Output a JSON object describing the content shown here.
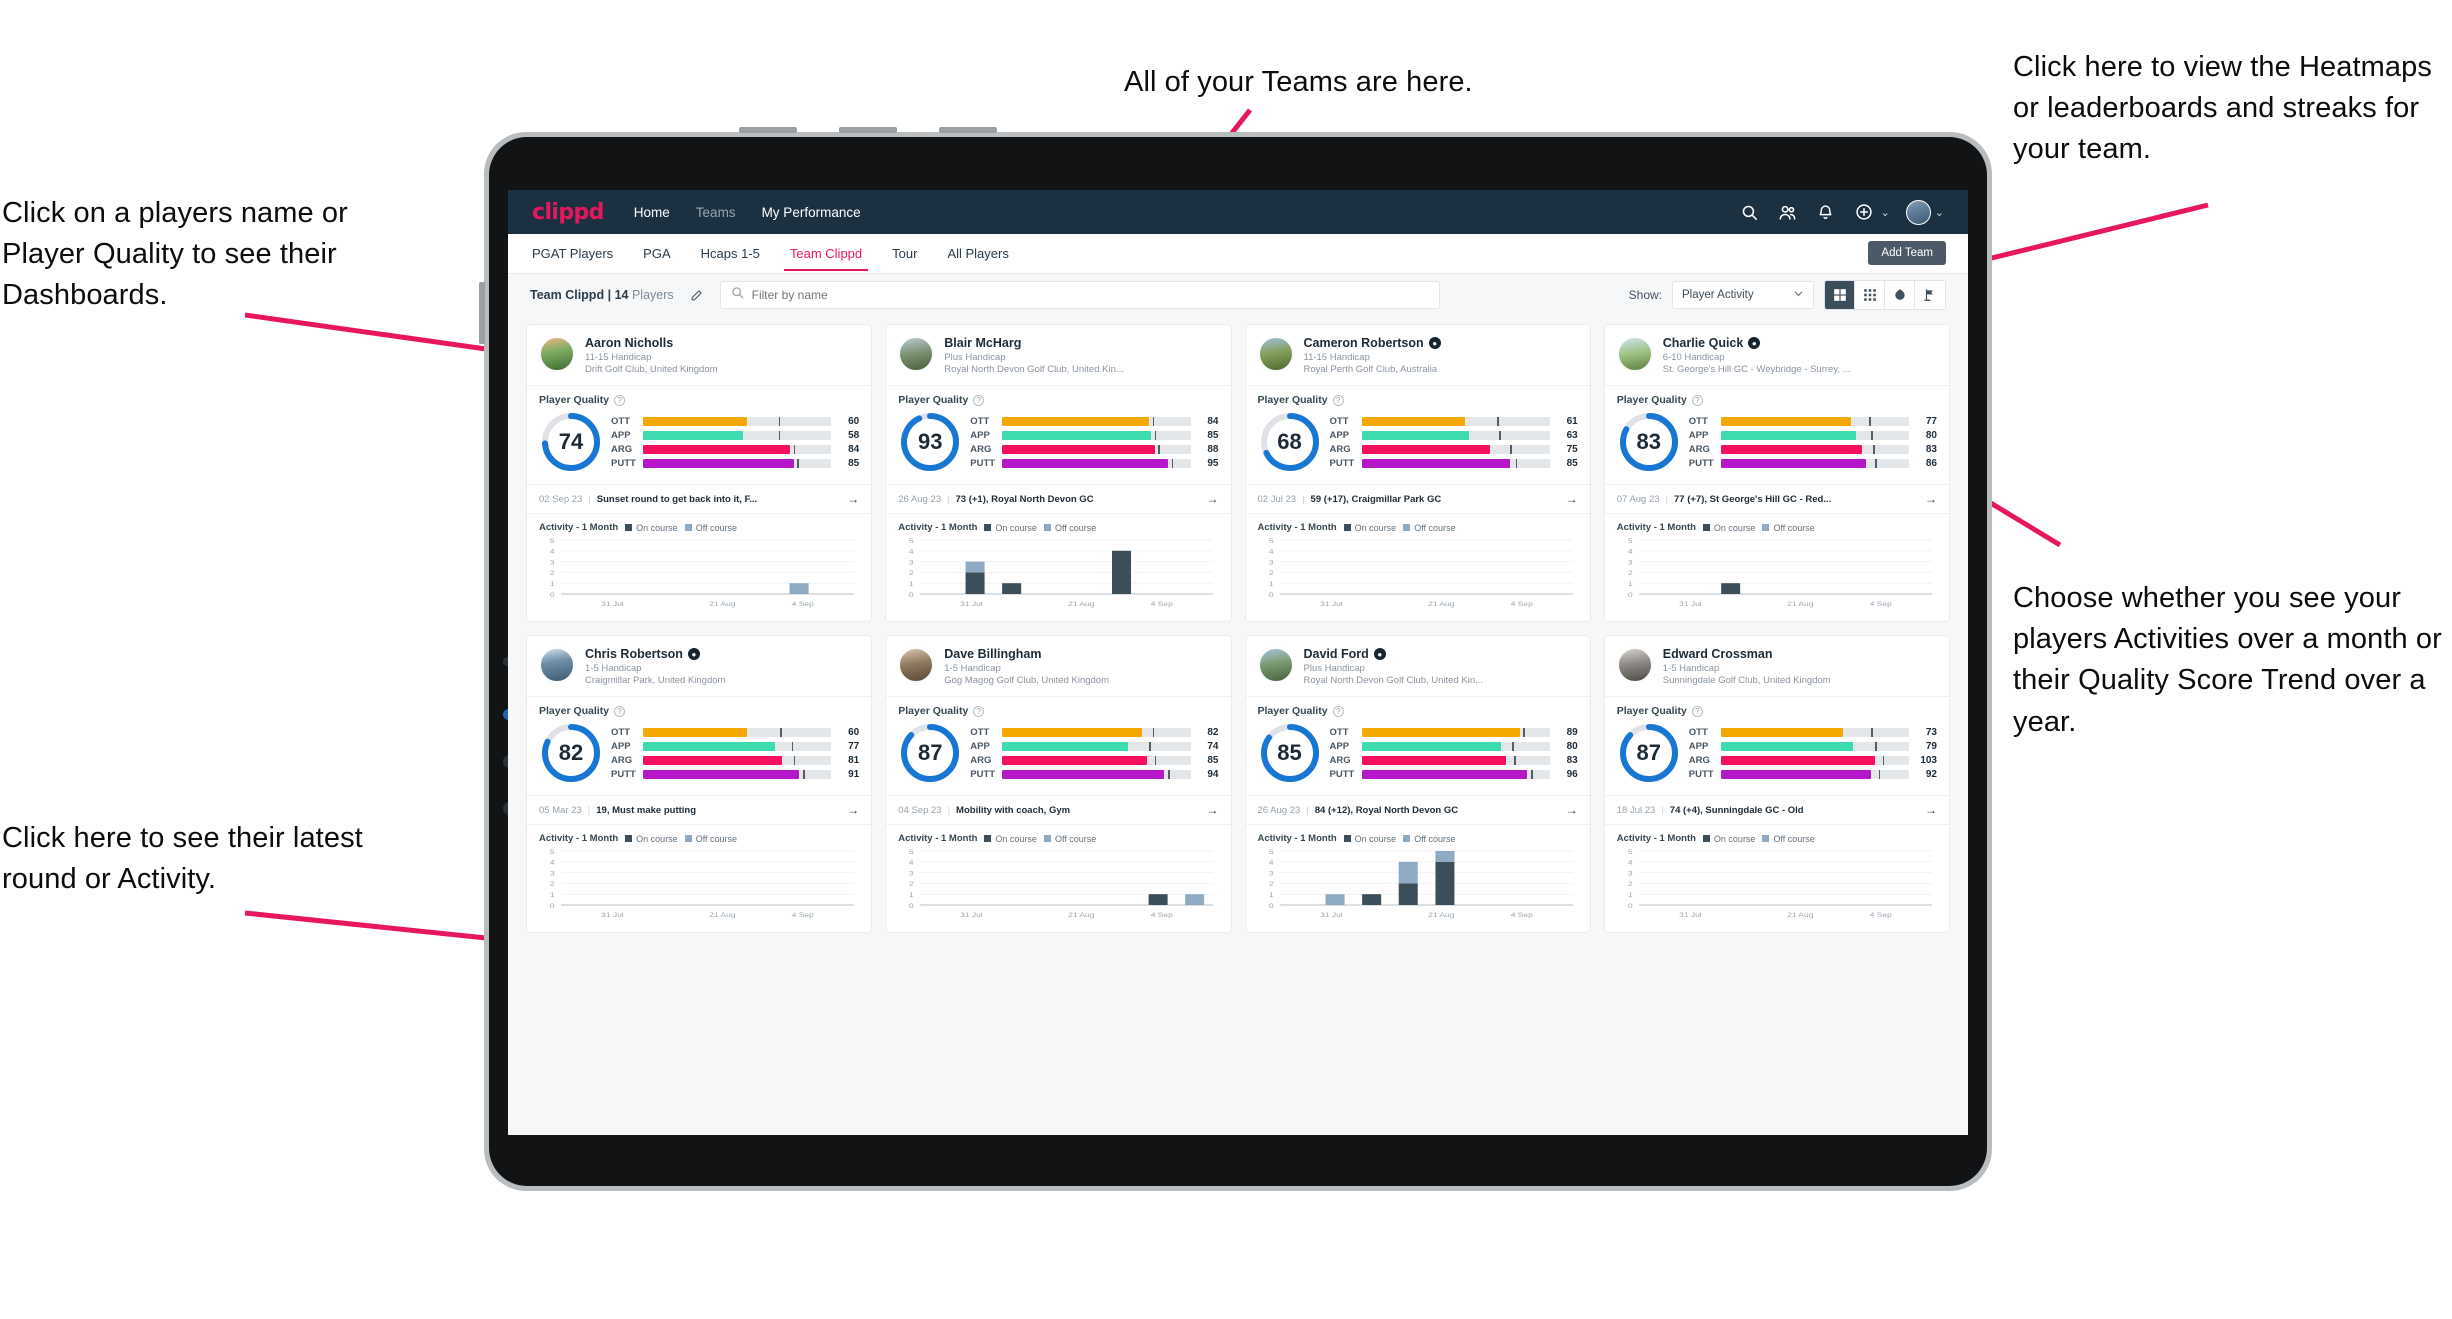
{
  "annotations": {
    "top_left": "Click on a players name or Player Quality to see their Dashboards.",
    "bottom_left": "Click here to see their latest round or Activity.",
    "top_center": "All of your Teams are here.",
    "top_right": "Click here to view the Heatmaps or leaderboards and streaks for your team.",
    "bottom_right": "Choose whether you see your players Activities over a month or their Quality Score Trend over a year.",
    "arrow_color": "#e8175d"
  },
  "topnav": {
    "logo": "clippd",
    "links": [
      {
        "label": "Home",
        "active": true
      },
      {
        "label": "Teams",
        "active": false
      },
      {
        "label": "My Performance",
        "active": true
      }
    ],
    "icons": [
      {
        "name": "search-icon"
      },
      {
        "name": "people-icon"
      },
      {
        "name": "bell-icon"
      },
      {
        "name": "plus-circle-icon"
      }
    ],
    "avatar_caret": "⌄",
    "plus_caret": "⌄"
  },
  "tabs": {
    "items": [
      {
        "label": "PGAT Players",
        "state": "dark"
      },
      {
        "label": "PGA",
        "state": "dark"
      },
      {
        "label": "Hcaps 1-5",
        "state": "dark"
      },
      {
        "label": "Team Clippd",
        "state": "active"
      },
      {
        "label": "Tour",
        "state": "dark"
      },
      {
        "label": "All Players",
        "state": "dark"
      }
    ],
    "add_team_label": "Add Team"
  },
  "filterbar": {
    "team_name": "Team Clippd",
    "divider": "|",
    "player_count": "14",
    "players_word": "Players",
    "edit_icon": "pencil-icon",
    "search_placeholder": "Filter by name",
    "search_value": "",
    "show_label": "Show:",
    "show_selected": "Player Activity",
    "show_options": [
      "Player Activity",
      "Quality Score Trend"
    ],
    "view_buttons": [
      {
        "name": "grid-large-view",
        "selected": true
      },
      {
        "name": "grid-small-view",
        "selected": false
      },
      {
        "name": "heatmap-view",
        "selected": false
      },
      {
        "name": "leaderboard-view",
        "selected": false
      }
    ]
  },
  "card_labels": {
    "player_quality": "Player Quality",
    "activity_title": "Activity - 1 Month",
    "legend_on": "On course",
    "legend_off": "Off course",
    "metric_names": [
      "OTT",
      "APP",
      "ARG",
      "PUTT"
    ],
    "arrow": "→"
  },
  "chart_data": {
    "type": "bar",
    "title": "Activity - 1 Month",
    "xlabel": "",
    "ylabel": "",
    "ylim": [
      0,
      5
    ],
    "yticks": [
      0,
      1,
      2,
      3,
      4,
      5
    ],
    "xtick_labels": [
      "31 Jul",
      "21 Aug",
      "4 Sep"
    ],
    "grid": true,
    "legend_position": "top",
    "stacked": true,
    "series_names": [
      "On course",
      "Off course"
    ],
    "series_colors": {
      "On course": "#3d4e5b",
      "Off course": "#8fabc4"
    },
    "charts": [
      {
        "player": "Aaron Nicholls",
        "bins": [
          {
            "slot": 6,
            "on": 0,
            "off": 1
          }
        ]
      },
      {
        "player": "Blair McHarg",
        "bins": [
          {
            "slot": 1,
            "on": 2,
            "off": 1
          },
          {
            "slot": 2,
            "on": 1,
            "off": 0
          },
          {
            "slot": 5,
            "on": 4,
            "off": 0
          }
        ]
      },
      {
        "player": "Cameron Robertson",
        "bins": []
      },
      {
        "player": "Charlie Quick",
        "bins": [
          {
            "slot": 2,
            "on": 1,
            "off": 0
          }
        ]
      },
      {
        "player": "Chris Robertson",
        "bins": []
      },
      {
        "player": "Dave Billingham",
        "bins": [
          {
            "slot": 6,
            "on": 1,
            "off": 0
          },
          {
            "slot": 7,
            "on": 0,
            "off": 1
          }
        ]
      },
      {
        "player": "David Ford",
        "bins": [
          {
            "slot": 1,
            "on": 0,
            "off": 1
          },
          {
            "slot": 2,
            "on": 1,
            "off": 0
          },
          {
            "slot": 3,
            "on": 2,
            "off": 2
          },
          {
            "slot": 4,
            "on": 4,
            "off": 1
          }
        ]
      },
      {
        "player": "Edward Crossman",
        "bins": []
      }
    ]
  },
  "players": [
    {
      "name": "Aaron Nicholls",
      "verified": false,
      "handicap": "11-15 Handicap",
      "club": "Drift Golf Club, United Kingdom",
      "quality": 74,
      "metrics": [
        {
          "label": "OTT",
          "value": 60,
          "fill": 55,
          "tick": 72,
          "color": "#f5a800"
        },
        {
          "label": "APP",
          "value": 58,
          "fill": 53,
          "tick": 72,
          "color": "#3ddbb0"
        },
        {
          "label": "ARG",
          "value": 84,
          "fill": 78,
          "tick": 80,
          "color": "#f50f5f"
        },
        {
          "label": "PUTT",
          "value": 85,
          "fill": 80,
          "tick": 82,
          "color": "#b617c9"
        }
      ],
      "round_date": "02 Sep 23",
      "round_text": "Sunset round to get back into it, F..."
    },
    {
      "name": "Blair McHarg",
      "verified": false,
      "handicap": "Plus Handicap",
      "club": "Royal North Devon Golf Club, United Kin...",
      "quality": 93,
      "metrics": [
        {
          "label": "OTT",
          "value": 84,
          "fill": 78,
          "tick": 80,
          "color": "#f5a800"
        },
        {
          "label": "APP",
          "value": 85,
          "fill": 79,
          "tick": 81,
          "color": "#3ddbb0"
        },
        {
          "label": "ARG",
          "value": 88,
          "fill": 81,
          "tick": 83,
          "color": "#f50f5f"
        },
        {
          "label": "PUTT",
          "value": 95,
          "fill": 88,
          "tick": 90,
          "color": "#b617c9"
        }
      ],
      "round_date": "26 Aug 23",
      "round_text": "73 (+1), Royal North Devon GC"
    },
    {
      "name": "Cameron Robertson",
      "verified": true,
      "handicap": "11-15 Handicap",
      "club": "Royal Perth Golf Club, Australia",
      "quality": 68,
      "metrics": [
        {
          "label": "OTT",
          "value": 61,
          "fill": 55,
          "tick": 72,
          "color": "#f5a800"
        },
        {
          "label": "APP",
          "value": 63,
          "fill": 57,
          "tick": 73,
          "color": "#3ddbb0"
        },
        {
          "label": "ARG",
          "value": 75,
          "fill": 68,
          "tick": 79,
          "color": "#f50f5f"
        },
        {
          "label": "PUTT",
          "value": 85,
          "fill": 79,
          "tick": 82,
          "color": "#b617c9"
        }
      ],
      "round_date": "02 Jul 23",
      "round_text": "59 (+17), Craigmillar Park GC"
    },
    {
      "name": "Charlie Quick",
      "verified": true,
      "handicap": "6-10 Handicap",
      "club": "St. George's Hill GC - Weybridge - Surrey, ...",
      "quality": 83,
      "metrics": [
        {
          "label": "OTT",
          "value": 77,
          "fill": 69,
          "tick": 79,
          "color": "#f5a800"
        },
        {
          "label": "APP",
          "value": 80,
          "fill": 72,
          "tick": 80,
          "color": "#3ddbb0"
        },
        {
          "label": "ARG",
          "value": 83,
          "fill": 75,
          "tick": 81,
          "color": "#f50f5f"
        },
        {
          "label": "PUTT",
          "value": 86,
          "fill": 77,
          "tick": 82,
          "color": "#b617c9"
        }
      ],
      "round_date": "07 Aug 23",
      "round_text": "77 (+7), St George's Hill GC - Red..."
    },
    {
      "name": "Chris Robertson",
      "verified": true,
      "handicap": "1-5 Handicap",
      "club": "Craigmillar Park, United Kingdom",
      "quality": 82,
      "metrics": [
        {
          "label": "OTT",
          "value": 60,
          "fill": 55,
          "tick": 73,
          "color": "#f5a800"
        },
        {
          "label": "APP",
          "value": 77,
          "fill": 70,
          "tick": 79,
          "color": "#3ddbb0"
        },
        {
          "label": "ARG",
          "value": 81,
          "fill": 74,
          "tick": 80,
          "color": "#f50f5f"
        },
        {
          "label": "PUTT",
          "value": 91,
          "fill": 83,
          "tick": 85,
          "color": "#b617c9"
        }
      ],
      "round_date": "05 Mar 23",
      "round_text": "19, Must make putting"
    },
    {
      "name": "Dave Billingham",
      "verified": false,
      "handicap": "1-5 Handicap",
      "club": "Gog Magog Golf Club, United Kingdom",
      "quality": 87,
      "metrics": [
        {
          "label": "OTT",
          "value": 82,
          "fill": 74,
          "tick": 80,
          "color": "#f5a800"
        },
        {
          "label": "APP",
          "value": 74,
          "fill": 67,
          "tick": 78,
          "color": "#3ddbb0"
        },
        {
          "label": "ARG",
          "value": 85,
          "fill": 77,
          "tick": 81,
          "color": "#f50f5f"
        },
        {
          "label": "PUTT",
          "value": 94,
          "fill": 86,
          "tick": 88,
          "color": "#b617c9"
        }
      ],
      "round_date": "04 Sep 23",
      "round_text": "Mobility with coach, Gym"
    },
    {
      "name": "David Ford",
      "verified": true,
      "handicap": "Plus Handicap",
      "club": "Royal North Devon Golf Club, United Kin...",
      "quality": 85,
      "metrics": [
        {
          "label": "OTT",
          "value": 89,
          "fill": 84,
          "tick": 86,
          "color": "#f5a800"
        },
        {
          "label": "APP",
          "value": 80,
          "fill": 74,
          "tick": 80,
          "color": "#3ddbb0"
        },
        {
          "label": "ARG",
          "value": 83,
          "fill": 77,
          "tick": 81,
          "color": "#f50f5f"
        },
        {
          "label": "PUTT",
          "value": 96,
          "fill": 88,
          "tick": 90,
          "color": "#b617c9"
        }
      ],
      "round_date": "26 Aug 23",
      "round_text": "84 (+12), Royal North Devon GC"
    },
    {
      "name": "Edward Crossman",
      "verified": false,
      "handicap": "1-5 Handicap",
      "club": "Sunningdale Golf Club, United Kingdom",
      "quality": 87,
      "metrics": [
        {
          "label": "OTT",
          "value": 73,
          "fill": 65,
          "tick": 80,
          "color": "#f5a800"
        },
        {
          "label": "APP",
          "value": 79,
          "fill": 70,
          "tick": 82,
          "color": "#3ddbb0"
        },
        {
          "label": "ARG",
          "value": 103,
          "fill": 82,
          "tick": 86,
          "color": "#f50f5f"
        },
        {
          "label": "PUTT",
          "value": 92,
          "fill": 80,
          "tick": 84,
          "color": "#b617c9"
        }
      ],
      "round_date": "18 Jul 23",
      "round_text": "74 (+4), Sunningdale GC - Old"
    }
  ]
}
